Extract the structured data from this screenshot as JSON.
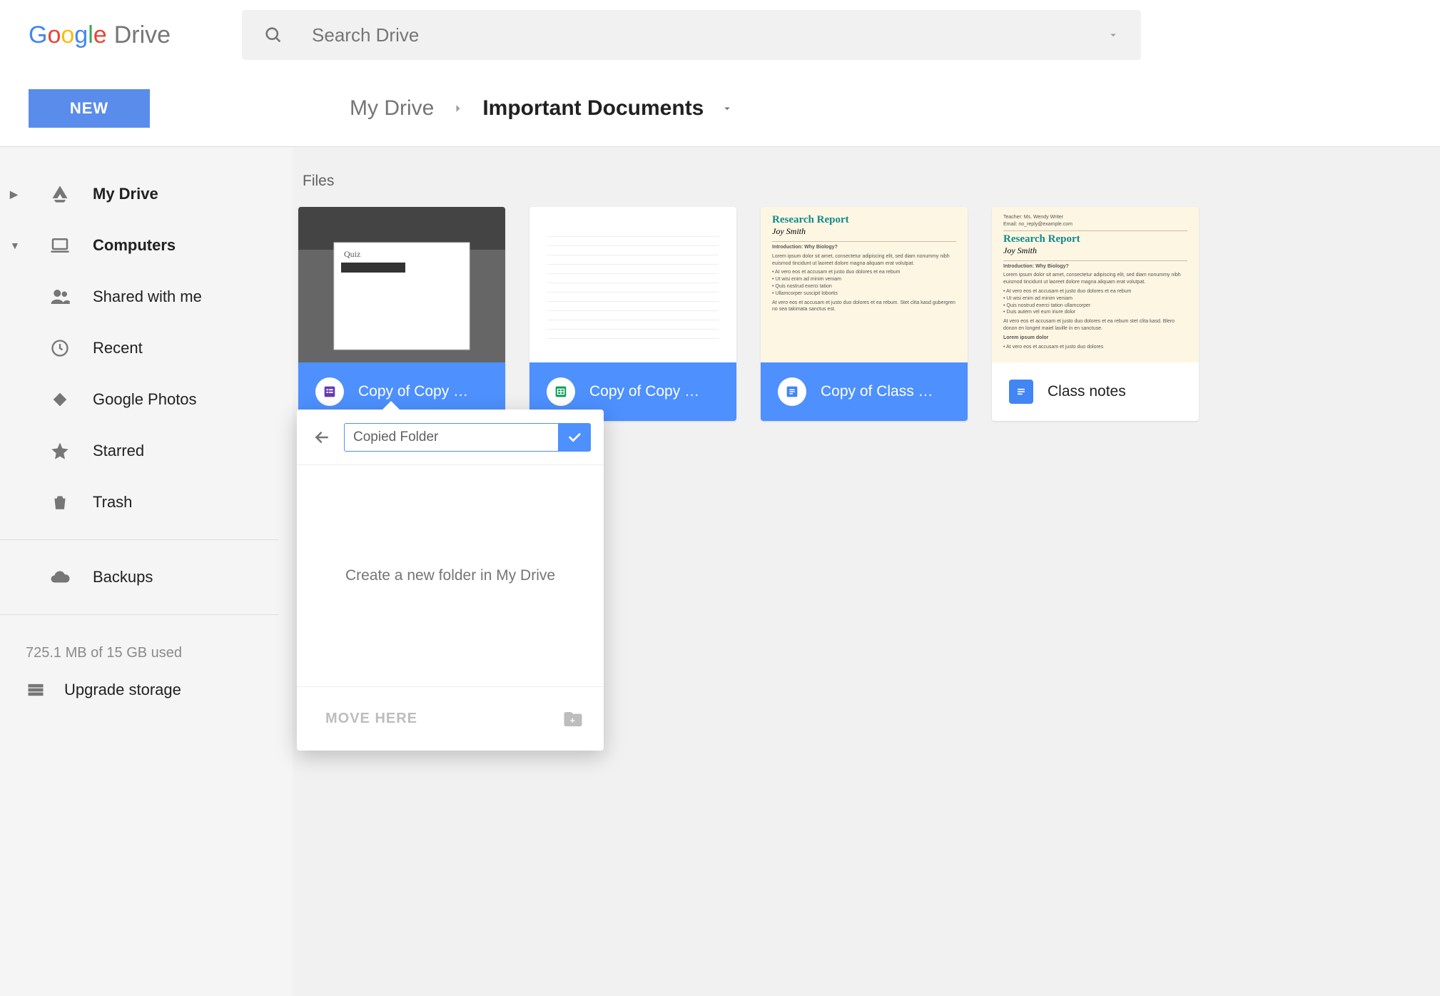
{
  "header": {
    "product_name": "Drive",
    "search_placeholder": "Search Drive"
  },
  "toolbar": {
    "new_label": "NEW"
  },
  "breadcrumb": {
    "root": "My Drive",
    "current": "Important Documents"
  },
  "sidebar": {
    "items": [
      {
        "label": "My Drive",
        "icon": "drive"
      },
      {
        "label": "Computers",
        "icon": "laptop"
      },
      {
        "label": "Shared with me",
        "icon": "people"
      },
      {
        "label": "Recent",
        "icon": "clock"
      },
      {
        "label": "Google Photos",
        "icon": "photos"
      },
      {
        "label": "Starred",
        "icon": "star"
      },
      {
        "label": "Trash",
        "icon": "trash"
      }
    ],
    "backups_label": "Backups",
    "storage_text": "725.1 MB of 15 GB used",
    "upgrade_label": "Upgrade storage"
  },
  "main": {
    "section_label": "Files",
    "files": [
      {
        "label": "Copy of Copy …",
        "type": "forms",
        "selected": true
      },
      {
        "label": "Copy of Copy …",
        "type": "sheets",
        "selected": true
      },
      {
        "label": "Copy of Class …",
        "type": "docs",
        "selected": true
      },
      {
        "label": "Class notes",
        "type": "docs",
        "selected": false
      }
    ]
  },
  "popover": {
    "folder_name": "Copied Folder",
    "body_text": "Create a new folder in My Drive",
    "move_label": "MOVE HERE"
  },
  "doc_preview": {
    "title": "Research Report",
    "author": "Joy Smith",
    "heading": "Introduction: Why Biology?"
  }
}
